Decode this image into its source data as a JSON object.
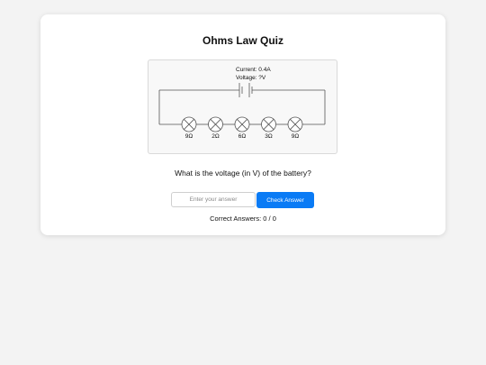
{
  "quiz": {
    "title": "Ohms Law Quiz",
    "question": "What is the voltage (in V) of the battery?",
    "input_placeholder": "Enter your answer",
    "input_value": "",
    "check_label": "Check Answer",
    "score_label": "Correct Answers: 0 / 0"
  },
  "circuit": {
    "current_label": "Current: 0.4A",
    "voltage_label": "Voltage: ?V",
    "resistors": [
      {
        "label": "9Ω"
      },
      {
        "label": "2Ω"
      },
      {
        "label": "6Ω"
      },
      {
        "label": "3Ω"
      },
      {
        "label": "9Ω"
      }
    ]
  },
  "colors": {
    "accent": "#0a7bf5",
    "wire": "#555555"
  }
}
